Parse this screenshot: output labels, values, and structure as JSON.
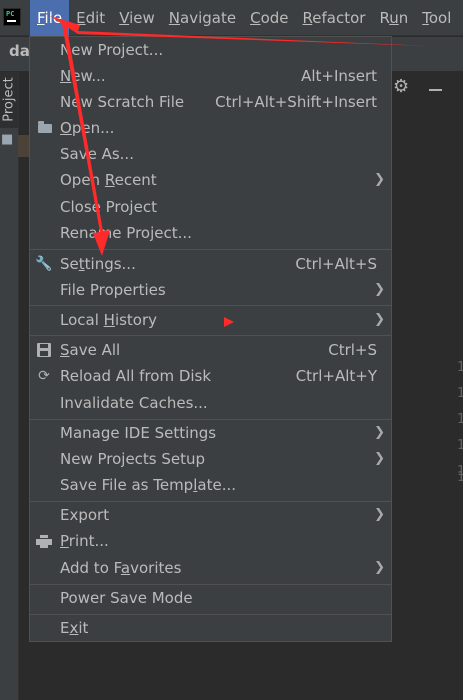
{
  "app": {
    "icon": "pycharm-logo-icon",
    "project_name": "day"
  },
  "menubar": {
    "items": [
      {
        "label": "File",
        "mnemonic": "F",
        "rest": "ile"
      },
      {
        "label": "Edit",
        "mnemonic": "E",
        "rest": "dit"
      },
      {
        "label": "View",
        "mnemonic": "V",
        "rest": "iew"
      },
      {
        "label": "Navigate",
        "mnemonic": "N",
        "rest": "avigate"
      },
      {
        "label": "Code",
        "mnemonic": "C",
        "rest": "ode"
      },
      {
        "label": "Refactor",
        "mnemonic": "R",
        "rest": "efactor"
      },
      {
        "label": "Run",
        "mnemonic": "u",
        "pre": "R",
        "rest": "n"
      },
      {
        "label": "Tool",
        "mnemonic": "T",
        "rest": "ool"
      }
    ]
  },
  "side": {
    "project_tab": "Project"
  },
  "gutter": [
    "1",
    "1",
    "1",
    "1",
    "1",
    "1"
  ],
  "file_menu": {
    "new_project": "New Project...",
    "new": {
      "pre": "",
      "mn": "N",
      "post": "ew...",
      "shortcut": "Alt+Insert"
    },
    "new_scratch": {
      "label": "New Scratch File",
      "shortcut": "Ctrl+Alt+Shift+Insert"
    },
    "open": {
      "mn": "O",
      "post": "pen..."
    },
    "save_as": "Save As...",
    "open_recent": {
      "pre": "Open ",
      "mn": "R",
      "post": "ecent"
    },
    "close_project": "Close Project",
    "rename_project": "Rename Project...",
    "settings": {
      "pre": "Se",
      "mn": "t",
      "post": "tings...",
      "shortcut": "Ctrl+Alt+S"
    },
    "file_properties": "File Properties",
    "local_history": {
      "pre": "Local ",
      "mn": "H",
      "post": "istory"
    },
    "save_all": {
      "mn": "S",
      "post": "ave All",
      "shortcut": "Ctrl+S"
    },
    "reload": {
      "label": "Reload All from Disk",
      "shortcut": "Ctrl+Alt+Y"
    },
    "invalidate": "Invalidate Caches...",
    "manage_ide": "Manage IDE Settings",
    "new_projects_setup": "New Projects Setup",
    "save_template": {
      "pre": "Save File as Temp",
      "mn": "l",
      "post": "ate..."
    },
    "export": "Export",
    "print": {
      "mn": "P",
      "post": "rint..."
    },
    "add_favorites": {
      "pre": "Add to F",
      "mn": "a",
      "post": "vorites"
    },
    "power_save": "Power Save Mode",
    "exit": {
      "pre": "E",
      "mn": "x",
      "post": "it"
    }
  },
  "colors": {
    "active_menu": "#4b6eaf",
    "menu_bg": "#3c3f41",
    "text": "#bbbbbb",
    "annotation": "#ff2a2a"
  }
}
